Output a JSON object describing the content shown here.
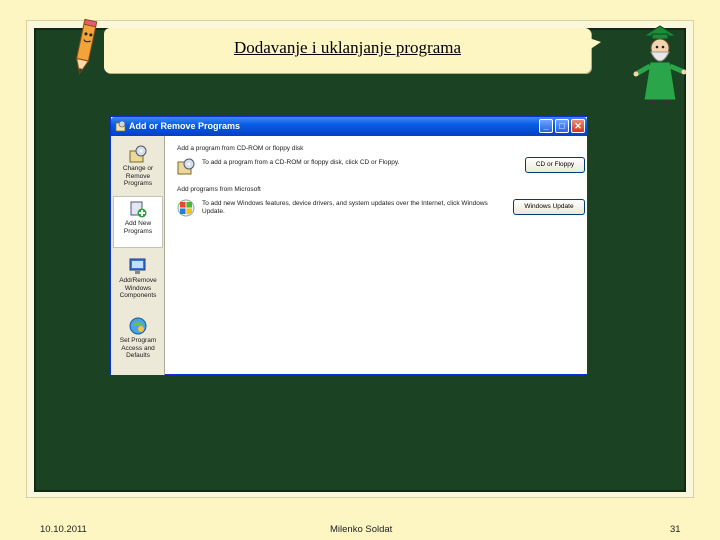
{
  "slide": {
    "title": "Dodavanje i uklanjanje programa"
  },
  "window": {
    "title": "Add or Remove Programs",
    "buttons": {
      "minimize": "_",
      "maximize": "□",
      "close": "✕"
    }
  },
  "sidebar": {
    "items": [
      {
        "label": "Change or Remove Programs",
        "icon": "cd-box-icon"
      },
      {
        "label": "Add New Programs",
        "icon": "add-programs-icon",
        "selected": true
      },
      {
        "label": "Add/Remove Windows Components",
        "icon": "windows-components-icon"
      },
      {
        "label": "Set Program Access and Defaults",
        "icon": "program-access-icon"
      }
    ]
  },
  "content": {
    "cd_section": {
      "heading": "Add a program from CD-ROM or floppy disk",
      "description": "To add a program from a CD-ROM or floppy disk, click CD or Floppy.",
      "button": "CD or Floppy"
    },
    "ms_section": {
      "heading": "Add programs from Microsoft",
      "description": "To add new Windows features, device drivers, and system updates over the Internet, click Windows Update.",
      "button": "Windows Update"
    }
  },
  "footer": {
    "date": "10.10.2011",
    "author": "Milenko Soldat",
    "page": "31"
  },
  "colors": {
    "slide_bg": "#fdf6c3",
    "board": "#1b4323",
    "xp_titlebar": "#0a5ce6",
    "xp_sidebar": "#ece9d8"
  }
}
